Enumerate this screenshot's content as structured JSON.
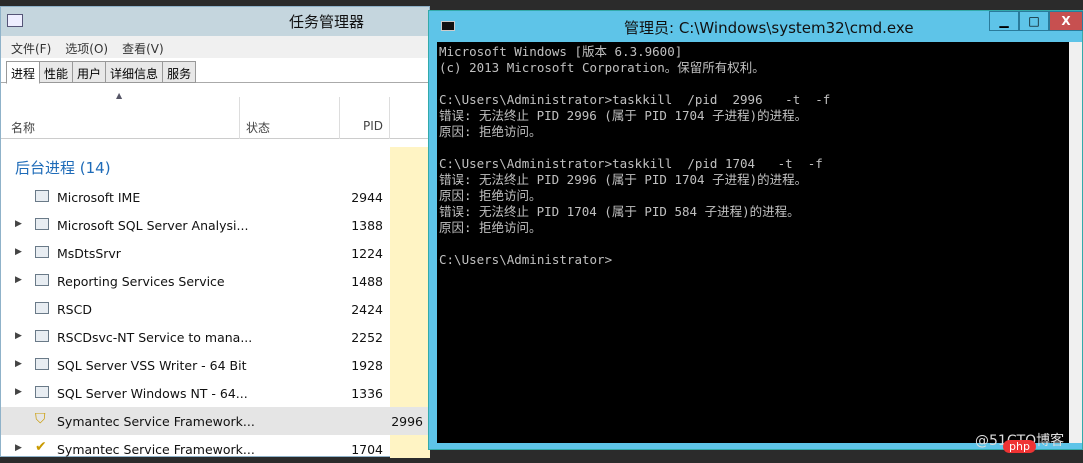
{
  "taskmgr": {
    "title": "任务管理器",
    "menu": [
      "文件(F)",
      "选项(O)",
      "查看(V)"
    ],
    "tabs": [
      "进程",
      "性能",
      "用户",
      "详细信息",
      "服务"
    ],
    "columns": {
      "name": "名称",
      "status": "状态",
      "pid": "PID"
    },
    "group": "后台进程 (14)",
    "rows": [
      {
        "name": "Microsoft IME",
        "pid": "2944",
        "expand": false,
        "icon": "window"
      },
      {
        "name": "Microsoft SQL Server Analysi...",
        "pid": "1388",
        "expand": true,
        "icon": "window"
      },
      {
        "name": "MsDtsSrvr",
        "pid": "1224",
        "expand": true,
        "icon": "window"
      },
      {
        "name": "Reporting Services Service",
        "pid": "1488",
        "expand": true,
        "icon": "window"
      },
      {
        "name": "RSCD",
        "pid": "2424",
        "expand": false,
        "icon": "window"
      },
      {
        "name": "RSCDsvc-NT Service to mana...",
        "pid": "2252",
        "expand": true,
        "icon": "window"
      },
      {
        "name": "SQL Server VSS Writer - 64 Bit",
        "pid": "1928",
        "expand": true,
        "icon": "window"
      },
      {
        "name": "SQL Server Windows NT - 64...",
        "pid": "1336",
        "expand": true,
        "icon": "window"
      },
      {
        "name": "Symantec Service Framework...",
        "pid": "2996",
        "expand": false,
        "icon": "shield",
        "selected": true
      },
      {
        "name": "Symantec Service Framework...",
        "pid": "1704",
        "expand": true,
        "icon": "shield-check"
      }
    ]
  },
  "cmd": {
    "title": "管理员: C:\\Windows\\system32\\cmd.exe",
    "buttons": {
      "min": "▁",
      "max": "□",
      "close": "X"
    },
    "lines": [
      "Microsoft Windows [版本 6.3.9600]",
      "(c) 2013 Microsoft Corporation。保留所有权利。",
      "",
      "C:\\Users\\Administrator>taskkill  /pid  2996   -t  -f",
      "错误: 无法终止 PID 2996 (属于 PID 1704 子进程)的进程。",
      "原因: 拒绝访问。",
      "",
      "C:\\Users\\Administrator>taskkill  /pid 1704   -t  -f",
      "错误: 无法终止 PID 2996 (属于 PID 1704 子进程)的进程。",
      "原因: 拒绝访问。",
      "错误: 无法终止 PID 1704 (属于 PID 584 子进程)的进程。",
      "原因: 拒绝访问。",
      "",
      "C:\\Users\\Administrator>"
    ]
  },
  "watermark": "@51CTO博客",
  "php_logo": "php"
}
